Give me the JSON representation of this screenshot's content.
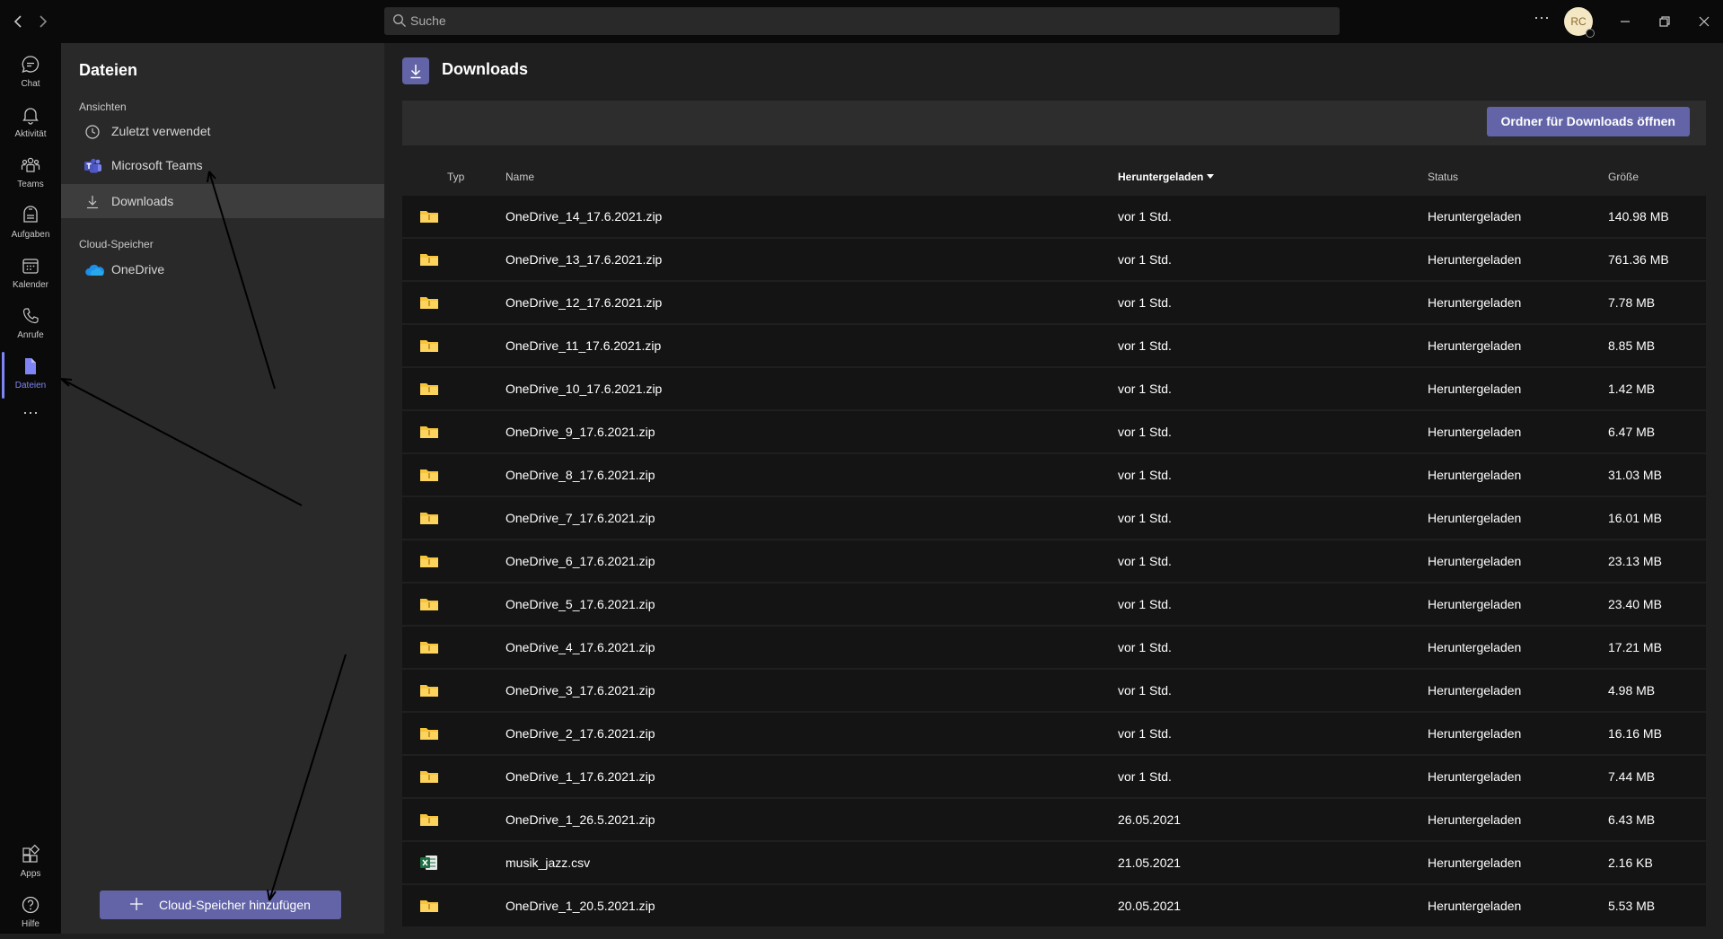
{
  "titlebar": {
    "search_placeholder": "Suche",
    "more_label": "⋯",
    "avatar_initials": "RC"
  },
  "appbar": {
    "items": [
      {
        "label": "Chat",
        "icon": "chat-icon"
      },
      {
        "label": "Aktivität",
        "icon": "bell-icon"
      },
      {
        "label": "Teams",
        "icon": "teams-icon"
      },
      {
        "label": "Aufgaben",
        "icon": "tasks-icon"
      },
      {
        "label": "Kalender",
        "icon": "calendar-icon"
      },
      {
        "label": "Anrufe",
        "icon": "phone-icon"
      },
      {
        "label": "Dateien",
        "icon": "file-icon",
        "active": true
      }
    ],
    "more_label": "⋯",
    "bottom_items": [
      {
        "label": "Apps",
        "icon": "apps-icon"
      },
      {
        "label": "Hilfe",
        "icon": "help-icon"
      }
    ]
  },
  "leftpanel": {
    "title": "Dateien",
    "views_header": "Ansichten",
    "views": [
      {
        "label": "Zuletzt verwendet",
        "icon": "clock-icon"
      },
      {
        "label": "Microsoft Teams",
        "icon": "teams-logo-icon"
      },
      {
        "label": "Downloads",
        "icon": "download-icon",
        "selected": true
      }
    ],
    "cloud_header": "Cloud-Speicher",
    "cloud": [
      {
        "label": "OneDrive",
        "icon": "onedrive-icon"
      }
    ],
    "add_button": "Cloud-Speicher hinzufügen"
  },
  "main": {
    "title": "Downloads",
    "open_button": "Ordner für Downloads öffnen",
    "columns": {
      "type": "Typ",
      "name": "Name",
      "downloaded": "Heruntergeladen",
      "status": "Status",
      "size": "Größe"
    },
    "rows": [
      {
        "type": "zip",
        "name": "OneDrive_14_17.6.2021.zip",
        "downloaded": "vor 1 Std.",
        "status": "Heruntergeladen",
        "size": "140.98 MB"
      },
      {
        "type": "zip",
        "name": "OneDrive_13_17.6.2021.zip",
        "downloaded": "vor 1 Std.",
        "status": "Heruntergeladen",
        "size": "761.36 MB"
      },
      {
        "type": "zip",
        "name": "OneDrive_12_17.6.2021.zip",
        "downloaded": "vor 1 Std.",
        "status": "Heruntergeladen",
        "size": "7.78 MB"
      },
      {
        "type": "zip",
        "name": "OneDrive_11_17.6.2021.zip",
        "downloaded": "vor 1 Std.",
        "status": "Heruntergeladen",
        "size": "8.85 MB"
      },
      {
        "type": "zip",
        "name": "OneDrive_10_17.6.2021.zip",
        "downloaded": "vor 1 Std.",
        "status": "Heruntergeladen",
        "size": "1.42 MB"
      },
      {
        "type": "zip",
        "name": "OneDrive_9_17.6.2021.zip",
        "downloaded": "vor 1 Std.",
        "status": "Heruntergeladen",
        "size": "6.47 MB"
      },
      {
        "type": "zip",
        "name": "OneDrive_8_17.6.2021.zip",
        "downloaded": "vor 1 Std.",
        "status": "Heruntergeladen",
        "size": "31.03 MB"
      },
      {
        "type": "zip",
        "name": "OneDrive_7_17.6.2021.zip",
        "downloaded": "vor 1 Std.",
        "status": "Heruntergeladen",
        "size": "16.01 MB"
      },
      {
        "type": "zip",
        "name": "OneDrive_6_17.6.2021.zip",
        "downloaded": "vor 1 Std.",
        "status": "Heruntergeladen",
        "size": "23.13 MB"
      },
      {
        "type": "zip",
        "name": "OneDrive_5_17.6.2021.zip",
        "downloaded": "vor 1 Std.",
        "status": "Heruntergeladen",
        "size": "23.40 MB"
      },
      {
        "type": "zip",
        "name": "OneDrive_4_17.6.2021.zip",
        "downloaded": "vor 1 Std.",
        "status": "Heruntergeladen",
        "size": "17.21 MB"
      },
      {
        "type": "zip",
        "name": "OneDrive_3_17.6.2021.zip",
        "downloaded": "vor 1 Std.",
        "status": "Heruntergeladen",
        "size": "4.98 MB"
      },
      {
        "type": "zip",
        "name": "OneDrive_2_17.6.2021.zip",
        "downloaded": "vor 1 Std.",
        "status": "Heruntergeladen",
        "size": "16.16 MB"
      },
      {
        "type": "zip",
        "name": "OneDrive_1_17.6.2021.zip",
        "downloaded": "vor 1 Std.",
        "status": "Heruntergeladen",
        "size": "7.44 MB"
      },
      {
        "type": "zip",
        "name": "OneDrive_1_26.5.2021.zip",
        "downloaded": "26.05.2021",
        "status": "Heruntergeladen",
        "size": "6.43 MB"
      },
      {
        "type": "excel",
        "name": "musik_jazz.csv",
        "downloaded": "21.05.2021",
        "status": "Heruntergeladen",
        "size": "2.16 KB"
      },
      {
        "type": "zip",
        "name": "OneDrive_1_20.5.2021.zip",
        "downloaded": "20.05.2021",
        "status": "Heruntergeladen",
        "size": "5.53 MB"
      }
    ]
  },
  "colors": {
    "accent": "#6264a7",
    "accent_light": "#7f85f5",
    "folder": "#f8c43a",
    "excel": "#1d6f42"
  }
}
